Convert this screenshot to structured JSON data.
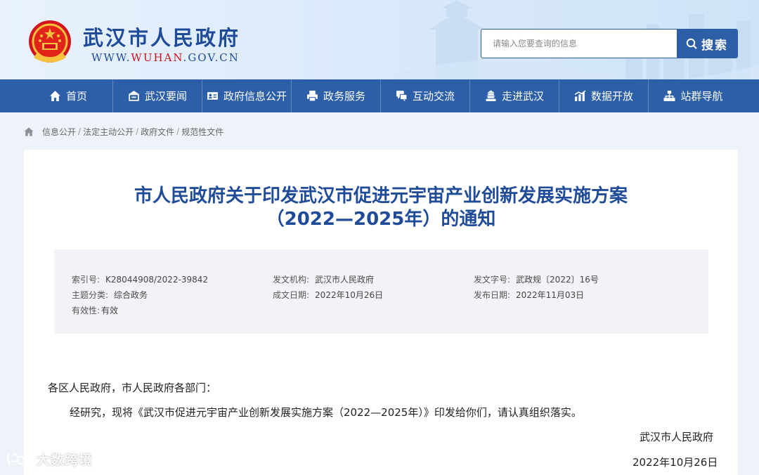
{
  "header": {
    "site_title": "武汉市人民政府",
    "site_url_pre": "WWW.",
    "site_url_hl": "WUHAN",
    "site_url_post": ".GOV.CN",
    "search_placeholder": "请输入您要查询的信息",
    "search_button": "搜索"
  },
  "nav": {
    "items": [
      {
        "label": "首页",
        "icon": "home-icon"
      },
      {
        "label": "武汉要闻",
        "icon": "news-icon"
      },
      {
        "label": "政府信息公开",
        "icon": "id-card-icon"
      },
      {
        "label": "政务服务",
        "icon": "printer-icon"
      },
      {
        "label": "互动交流",
        "icon": "chat-icon"
      },
      {
        "label": "走进武汉",
        "icon": "landmark-icon"
      },
      {
        "label": "数据开放",
        "icon": "chart-icon"
      },
      {
        "label": "站群导航",
        "icon": "sitemap-icon"
      }
    ]
  },
  "breadcrumb": [
    "信息公开",
    "法定主动公开",
    "政府文件",
    "规范性文件"
  ],
  "document": {
    "title_line1": "市人民政府关于印发武汉市促进元宇宙产业创新发展实施方案",
    "title_line2": "（2022—2025年）的通知",
    "meta": {
      "index_key": "索引号:",
      "index_val": "K28044908/2022-39842",
      "issuer_key": "发文机构:",
      "issuer_val": "武汉市人民政府",
      "docno_key": "发文字号:",
      "docno_val": "武政规〔2022〕16号",
      "topic_key": "主题分类:",
      "topic_val": "综合政务",
      "created_key": "成文日期:",
      "created_val": "2022年10月26日",
      "published_key": "发布日期:",
      "published_val": "2022年11月03日",
      "validity_key": "有效性:",
      "validity_val": "有效"
    },
    "salutation": "各区人民政府，市人民政府各部门：",
    "body": "经研究，现将《武汉市促进元宇宙产业创新发展实施方案（2022—2025年）》印发给你们，请认真组织落实。",
    "signature": "武汉市人民政府",
    "date": "2022年10月26日"
  },
  "watermark": "大数跨境",
  "colors": {
    "primary": "#2c5fa8",
    "title": "#1f4b99",
    "url_accent": "#c8161d"
  }
}
